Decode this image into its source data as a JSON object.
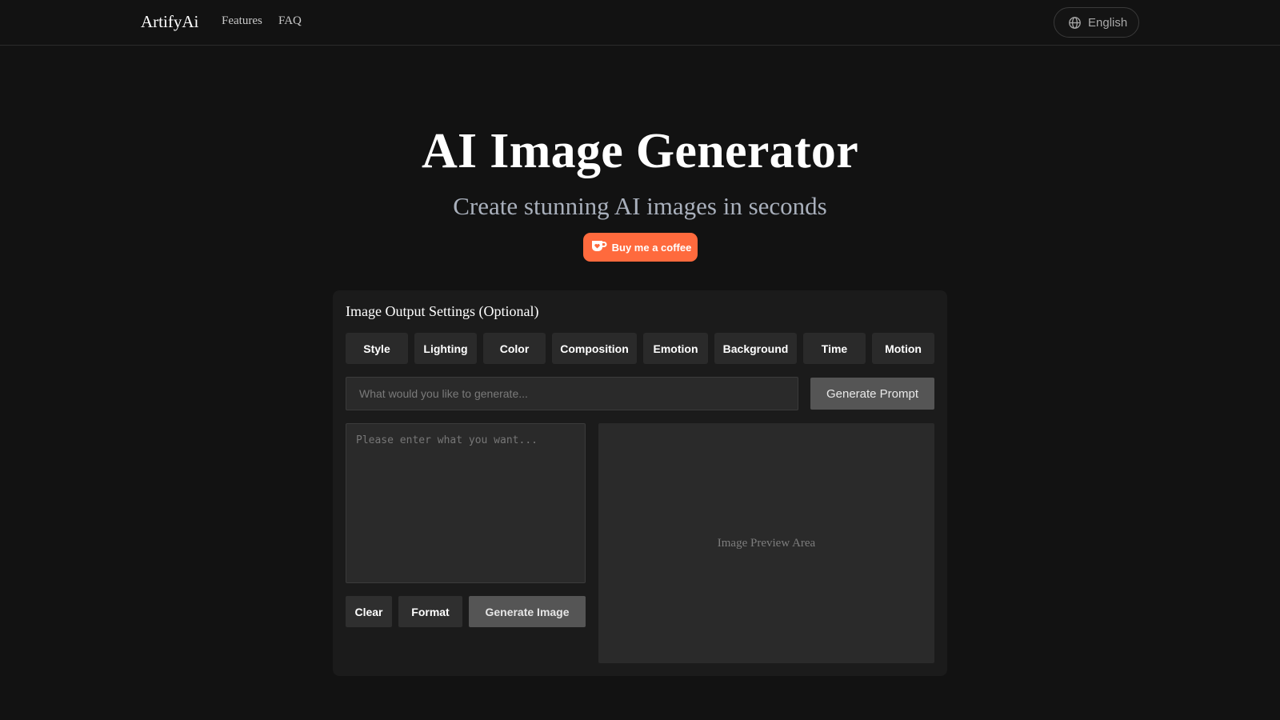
{
  "header": {
    "brand": "ArtifyAi",
    "nav": {
      "features": "Features",
      "faq": "FAQ"
    },
    "language": {
      "label": "English",
      "icon": "globe-icon"
    }
  },
  "hero": {
    "title": "AI Image Generator",
    "subtitle": "Create stunning AI images in seconds",
    "coffee": {
      "label": "Buy me a coffee",
      "icon": "coffee-cup-icon",
      "color": "#ff6a3d"
    }
  },
  "settings": {
    "title": "Image Output Settings (Optional)",
    "categories": [
      {
        "label": "Style"
      },
      {
        "label": "Lighting"
      },
      {
        "label": "Color"
      },
      {
        "label": "Composition"
      },
      {
        "label": "Emotion"
      },
      {
        "label": "Background"
      },
      {
        "label": "Time"
      },
      {
        "label": "Motion"
      }
    ],
    "prompt_input": {
      "value": "",
      "placeholder": "What would you like to generate..."
    },
    "generate_prompt_label": "Generate Prompt",
    "textarea": {
      "value": "",
      "placeholder": "Please enter what you want..."
    },
    "actions": {
      "clear": "Clear",
      "format": "Format",
      "generate_image": "Generate Image"
    },
    "preview_text": "Image Preview Area"
  },
  "colors": {
    "background": "#121212",
    "card": "#1b1b1b",
    "field": "#2a2a2a",
    "primary_button": "#555555",
    "accent": "#ff6a3d"
  }
}
